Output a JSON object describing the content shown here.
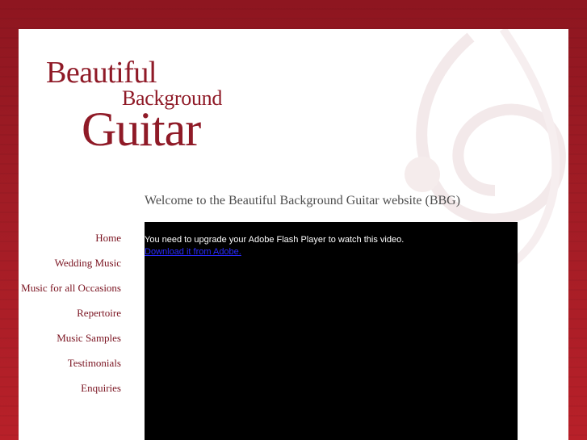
{
  "logo": {
    "line1": "Beautiful",
    "line2": "Background",
    "line3": "Guitar"
  },
  "welcome": "Welcome to the Beautiful Background Guitar website (BBG)",
  "nav": {
    "items": [
      {
        "label": "Home"
      },
      {
        "label": "Wedding Music"
      },
      {
        "label": "Music for all Occasions"
      },
      {
        "label": "Repertoire"
      },
      {
        "label": "Music Samples"
      },
      {
        "label": "Testimonials"
      },
      {
        "label": "Enquiries"
      }
    ]
  },
  "video": {
    "message": "You need to upgrade your Adobe Flash Player to watch this video.",
    "download_link": "Download it from Adobe."
  },
  "colors": {
    "brand": "#8f1a27",
    "nav_text": "#7a1320",
    "background": "#a11c25",
    "video_bg": "#000000",
    "link": "#2a2aff"
  }
}
